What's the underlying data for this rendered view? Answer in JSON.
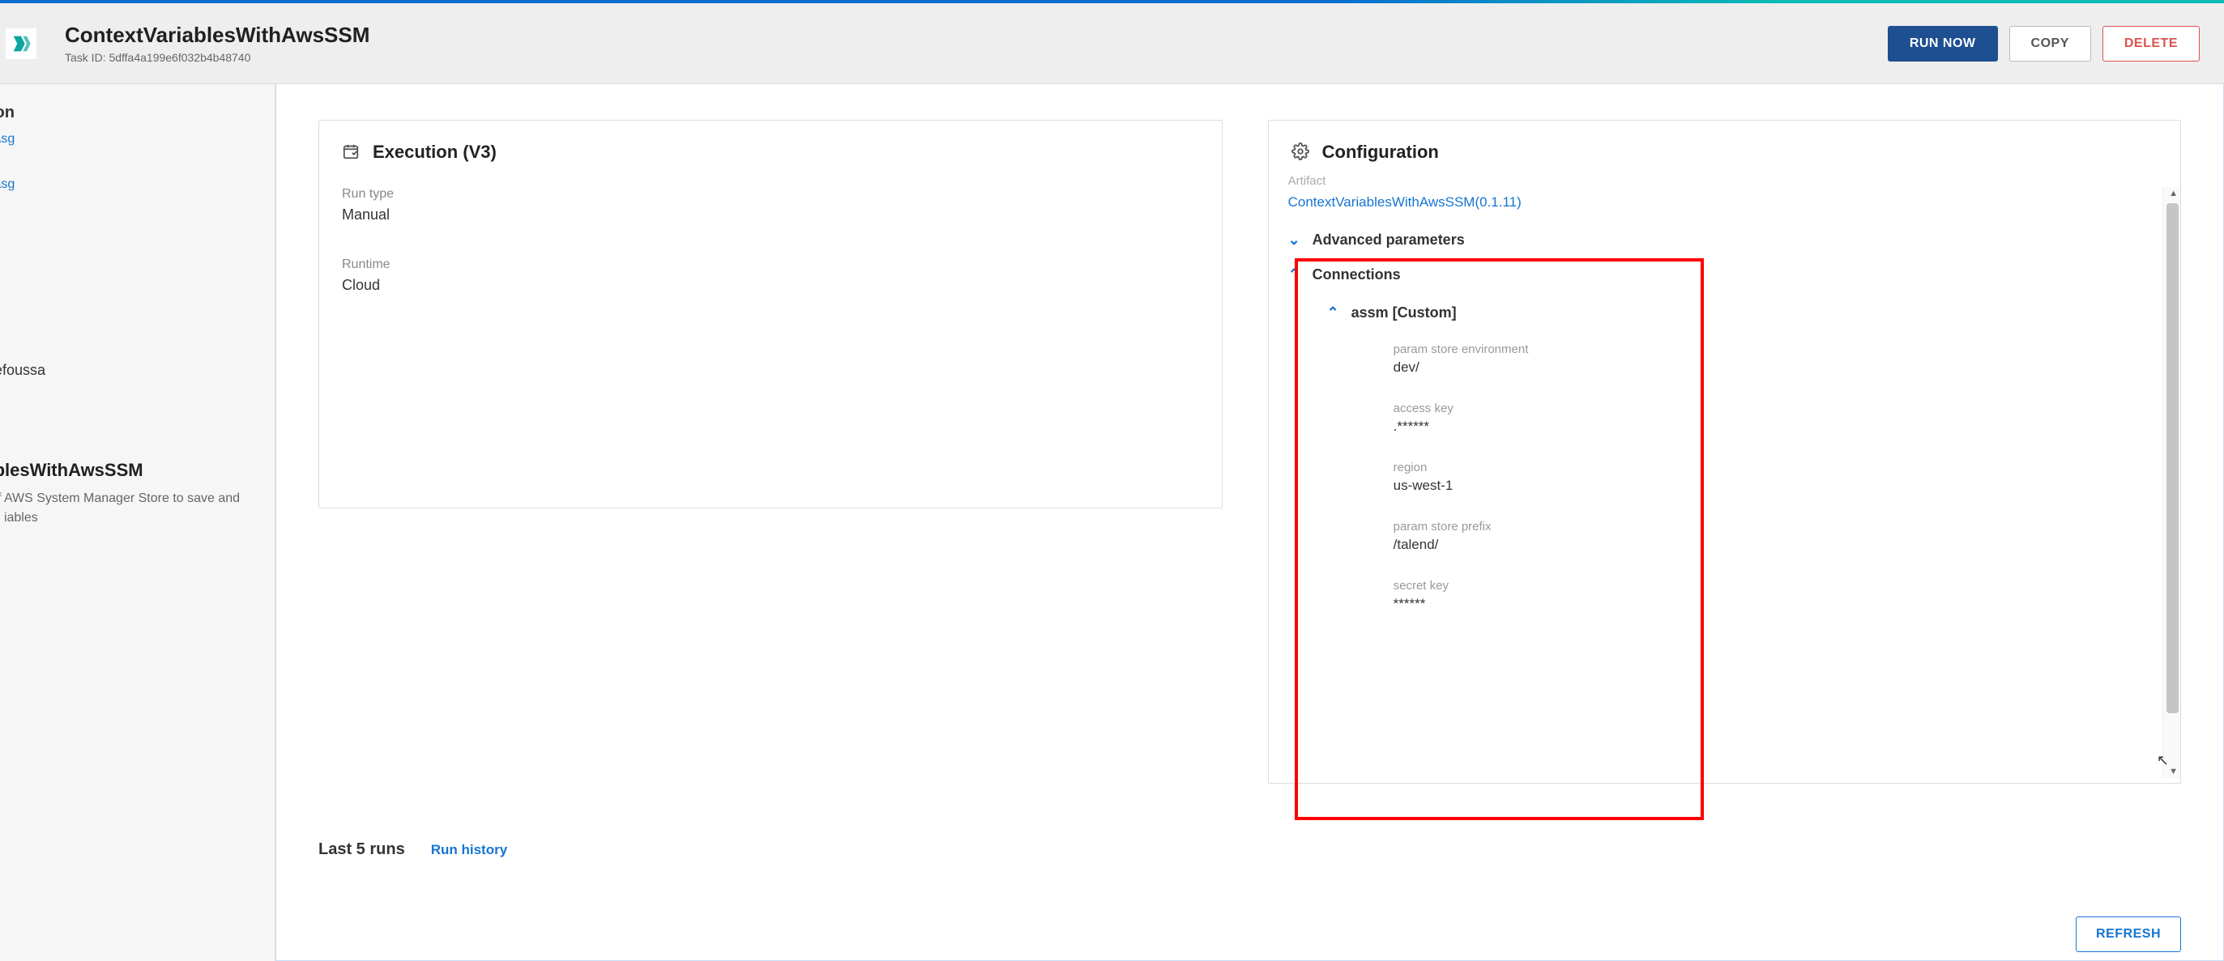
{
  "header": {
    "title": "ContextVariablesWithAwsSSM",
    "subtitle": "Task ID: 5dffa4a199e6f032b4b48740",
    "run_now": "RUN NOW",
    "copy": "COPY",
    "delete": "DELETE"
  },
  "sidebar": {
    "heading": "ion",
    "link1": ".asg",
    "link2": ".asg",
    "user": "ukefoussa",
    "artifact_title": "VariablesWithAwsSSM",
    "desc": "usage of AWS System Manager Store to save and load Job iables"
  },
  "execution": {
    "panel_title": "Execution (V3)",
    "run_type_lbl": "Run type",
    "run_type_val": "Manual",
    "runtime_lbl": "Runtime",
    "runtime_val": "Cloud"
  },
  "configuration": {
    "panel_title": "Configuration",
    "artifact_lbl": "Artifact",
    "artifact_link": "ContextVariablesWithAwsSSM(0.1.11)",
    "advanced_params": "Advanced parameters",
    "connections": "Connections",
    "conn_name": "assm [Custom]",
    "params": [
      {
        "lbl": "param store environment",
        "val": "dev/"
      },
      {
        "lbl": "access key",
        "val": ".******"
      },
      {
        "lbl": "region",
        "val": "us-west-1"
      },
      {
        "lbl": "param store prefix",
        "val": "/talend/"
      },
      {
        "lbl": "secret key",
        "val": "******"
      }
    ]
  },
  "bottom": {
    "title": "Last 5 runs",
    "history": "Run history",
    "refresh": "REFRESH"
  }
}
